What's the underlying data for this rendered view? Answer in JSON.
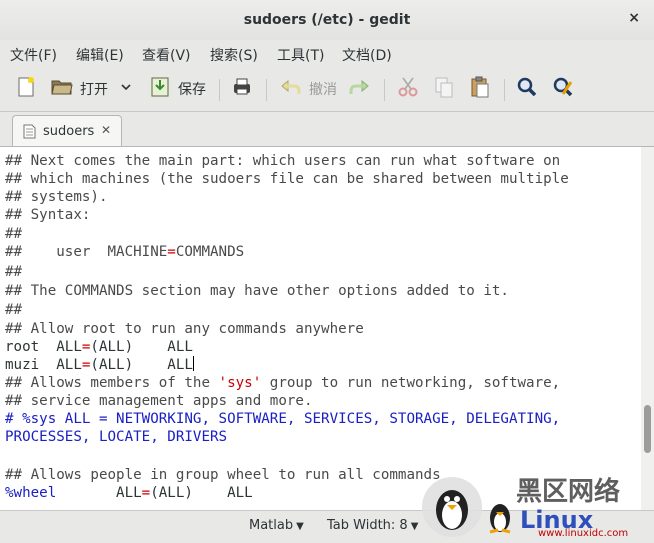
{
  "window": {
    "title": "sudoers (/etc) - gedit",
    "close_glyph": "×"
  },
  "menu": [
    {
      "label": "文件(F)"
    },
    {
      "label": "编辑(E)"
    },
    {
      "label": "查看(V)"
    },
    {
      "label": "搜索(S)"
    },
    {
      "label": "工具(T)"
    },
    {
      "label": "文档(D)"
    }
  ],
  "toolbar": {
    "new_icon": "new-document-icon",
    "open_label": "打开",
    "save_label": "保存",
    "print_icon": "printer-icon",
    "undo_label": "撤消",
    "redo_icon": "redo-icon",
    "cut_icon": "scissors-icon",
    "copy_icon": "copy-icon",
    "paste_icon": "paste-icon",
    "find_icon": "magnifier-icon",
    "replace_icon": "find-replace-icon"
  },
  "tab": {
    "label": "sudoers",
    "close_glyph": "✕"
  },
  "editor": {
    "lines": {
      "l1": "## Next comes the main part: which users can run what software on",
      "l2": "## which machines (the sudoers file can be shared between multiple",
      "l3": "## systems).",
      "l4": "## Syntax:",
      "l5": "##",
      "l6a": "##    user  MACHINE",
      "l6b": "=",
      "l6c": "COMMANDS",
      "l7": "##",
      "l8": "## The COMMANDS section may have other options added to it.",
      "l9": "##",
      "l10": "## Allow root to run any commands anywhere",
      "l11a": "root  ALL",
      "l11b": "=",
      "l11c": "(ALL)    ALL",
      "l12a": "muzi  ALL",
      "l12b": "=",
      "l12c": "(ALL)    ALL",
      "l13a": "## Allows members of the ",
      "l13b": "'sys'",
      "l13c": " group to run networking, software,",
      "l14": "## service management apps and more.",
      "l15": "# %sys ALL = NETWORKING, SOFTWARE, SERVICES, STORAGE, DELEGATING,",
      "l16": "PROCESSES, LOCATE, DRIVERS",
      "l17": "",
      "l18": "## Allows people in group wheel to run all commands",
      "l19a": "%wheel",
      "l19b": "       ALL",
      "l19c": "=",
      "l19d": "(ALL)    ALL"
    }
  },
  "statusbar": {
    "language": "Matlab",
    "tab_width": "Tab Width: 8"
  },
  "watermark": {
    "text": "黑区网络",
    "sub": "Linux",
    "site": "www.linuxidc.com",
    "logo_icon": "tux-penguin-icon"
  },
  "colors": {
    "comment": "#4a4a4a",
    "keyword_red": "#cc0000",
    "blue_text": "#1a20c4",
    "window_bg": "#e8e8e7"
  }
}
